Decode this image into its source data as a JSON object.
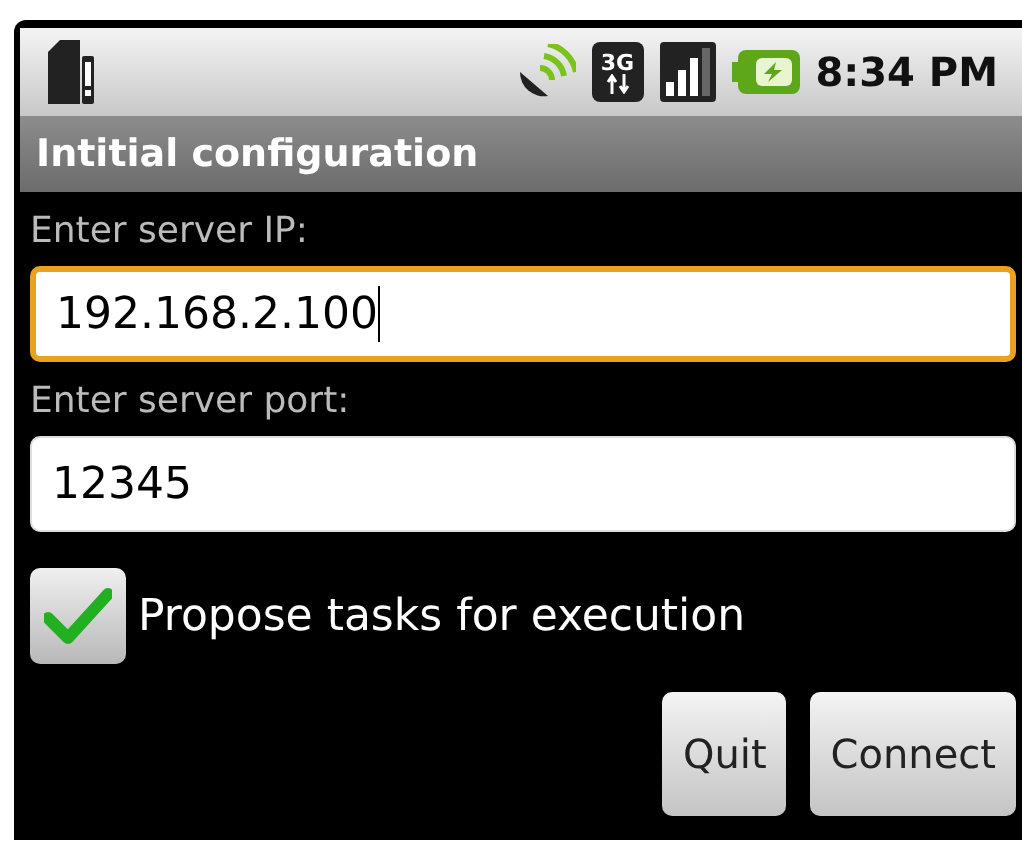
{
  "status_bar": {
    "time": "8:34 PM",
    "network": "3G"
  },
  "window": {
    "title": "Intitial configuration"
  },
  "fields": [
    {
      "label": "Enter server IP:",
      "value": "192.168.2.100",
      "focused": true
    },
    {
      "label": "Enter server port:",
      "value": "12345",
      "focused": false
    }
  ],
  "checkbox": {
    "label": "Propose tasks for execution",
    "checked": true
  },
  "buttons": [
    "Quit",
    "Connect"
  ]
}
